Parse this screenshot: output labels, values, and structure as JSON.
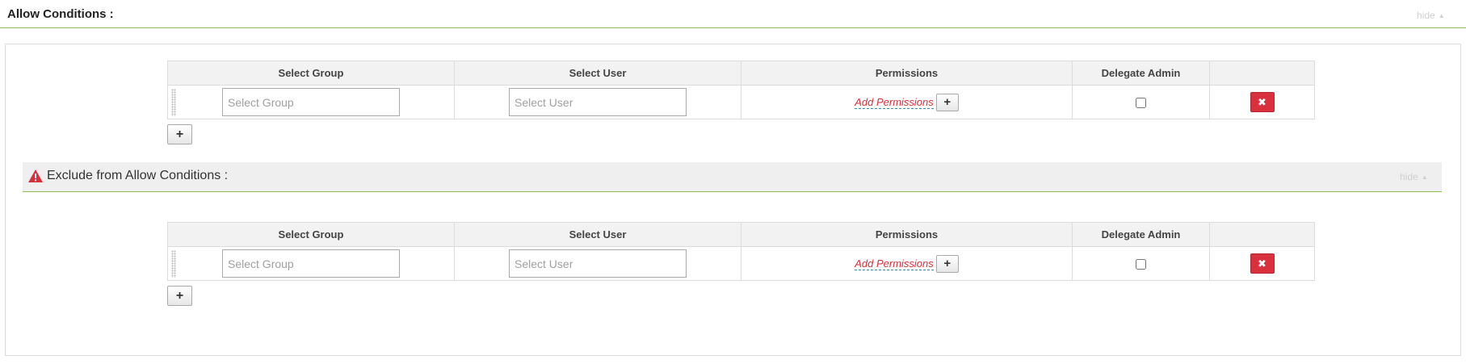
{
  "allow_section": {
    "title": "Allow Conditions :",
    "hide_label": "hide"
  },
  "exclude_section": {
    "title": "Exclude from Allow Conditions :",
    "hide_label": "hide"
  },
  "table": {
    "columns": [
      "Select Group",
      "Select User",
      "Permissions",
      "Delegate Admin",
      ""
    ],
    "group_placeholder": "Select Group",
    "user_placeholder": "Select User",
    "add_permissions_label": "Add Permissions",
    "plus_symbol": "+",
    "delete_symbol": "✖"
  },
  "colors": {
    "accent_line": "#8cc152",
    "delete_button": "#d9303e",
    "warning_icon": "#d9303e",
    "link_text": "#d9303e"
  },
  "icons": {
    "warning": "warning-triangle-icon",
    "delete": "close-icon",
    "add": "plus-icon",
    "drag": "drag-handle-icon"
  }
}
